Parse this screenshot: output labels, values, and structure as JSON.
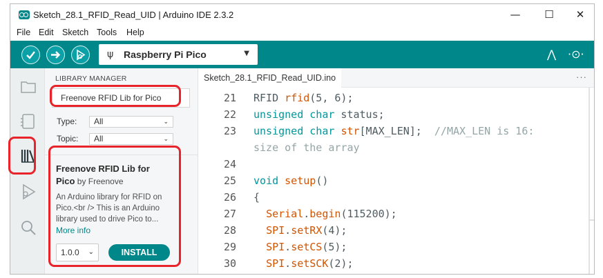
{
  "window": {
    "title": "Sketch_28.1_RFID_Read_UID | Arduino IDE 2.3.2",
    "minimize": "—",
    "maximize": "☐",
    "close": "✕"
  },
  "menu": [
    "File",
    "Edit",
    "Sketch",
    "Tools",
    "Help"
  ],
  "toolbar": {
    "board": "Raspberry Pi Pico",
    "usb_glyph": "ψ",
    "serial_plotter_glyph": "⋀",
    "serial_monitor_glyph": "·⊙·"
  },
  "library_manager": {
    "title": "LIBRARY MANAGER",
    "search_value": "Freenove RFID Lib for Pico",
    "type_label": "Type:",
    "type_value": "All",
    "topic_label": "Topic:",
    "topic_value": "All",
    "caret": "⌄",
    "card": {
      "name_line1": "Freenove RFID Lib for",
      "name_line2": "Pico",
      "author": " by Freenove",
      "desc_1": "An Arduino library for RFID on",
      "desc_2": "Pico.<br /> This is an Arduino",
      "desc_3": "library used to drive Pico to...",
      "more_info": "More info",
      "version": "1.0.0",
      "install": "INSTALL"
    }
  },
  "editor": {
    "tab": "Sketch_28.1_RFID_Read_UID.ino",
    "more": "···",
    "lines": [
      {
        "n": "21",
        "a": "RFID ",
        "b": "rfid",
        "c": "(5, 6);"
      },
      {
        "n": "22",
        "a": "unsigned",
        "b": " char",
        "c": " status;"
      },
      {
        "n": "23",
        "a": "unsigned",
        "b": " char",
        "c": " ",
        "d": "str",
        "e": "[MAX_LEN];  ",
        "f": "//MAX_LEN is 16:"
      },
      {
        "wrap": "size of the array"
      },
      {
        "n": "24"
      },
      {
        "n": "25",
        "a": "void",
        "b": " ",
        "c": "setup",
        "d": "()"
      },
      {
        "n": "26",
        "a": "{"
      },
      {
        "n": "27",
        "a": "  ",
        "b": "Serial",
        "c": ".",
        "d": "begin",
        "e": "(115200);"
      },
      {
        "n": "28",
        "a": "  ",
        "b": "SPI",
        "c": ".",
        "d": "setRX",
        "e": "(4);"
      },
      {
        "n": "29",
        "a": "  ",
        "b": "SPI",
        "c": ".",
        "d": "setCS",
        "e": "(5);"
      },
      {
        "n": "30",
        "a": "  ",
        "b": "SPI",
        "c": ".",
        "d": "setSCK",
        "e": "(2);"
      }
    ]
  },
  "colors": {
    "accent": "#00878a",
    "keyword": "#00979c",
    "function": "#d35400",
    "comment": "#95a5a6",
    "highlight": "#e8232a"
  }
}
